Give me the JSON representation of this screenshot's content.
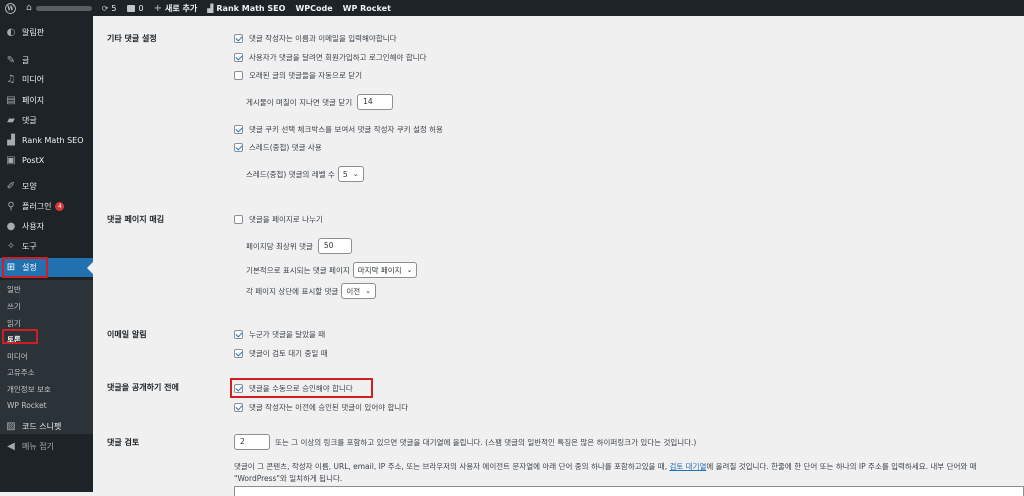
{
  "adminbar": {
    "updates_count": "5",
    "comments_count": "0",
    "new_label": "새로 추가",
    "plugins": [
      "Rank Math SEO",
      "WPCode",
      "WP Rocket"
    ]
  },
  "sidebar": {
    "items": [
      {
        "label": "알림판",
        "icon": "dashboard-icon"
      },
      {
        "label": "글",
        "icon": "pin-icon"
      },
      {
        "label": "미디어",
        "icon": "media-icon"
      },
      {
        "label": "페이지",
        "icon": "page-icon"
      },
      {
        "label": "댓글",
        "icon": "comment-icon"
      },
      {
        "label": "Rank Math SEO",
        "icon": "chart-icon"
      },
      {
        "label": "PostX",
        "icon": "postx-icon"
      },
      {
        "label": "모양",
        "icon": "brush-icon"
      },
      {
        "label": "플러그인",
        "icon": "plugin-icon",
        "badge": "4"
      },
      {
        "label": "사용자",
        "icon": "user-icon"
      },
      {
        "label": "도구",
        "icon": "wrench-icon"
      },
      {
        "label": "설정",
        "icon": "settings-icon"
      }
    ],
    "submenu": [
      "일반",
      "쓰기",
      "읽기",
      "토론",
      "미디어",
      "고유주소",
      "개인정보 보호",
      "WP Rocket"
    ],
    "after": [
      {
        "label": "코드 스니펫",
        "icon": "code-icon"
      },
      {
        "label": "메뉴 접기",
        "icon": "collapse-icon"
      }
    ]
  },
  "sections": {
    "other": {
      "title": "기타 댓글 설정",
      "opt1": "댓글 작성자는 이름과 이메일을 입력해야합니다",
      "opt2": "사용자가 댓글을 달려면 회원가입하고 로그인해야 합니다",
      "opt3": "오래된 글의 댓글들을 자동으로 닫기",
      "close_label": "게시물이 며칠이 지나면 댓글 닫기",
      "close_days": "14",
      "opt4": "댓글 쿠키 선택 체크박스를 보여서 댓글 작성자 쿠키 설정 허용",
      "opt5": "스레드(중첩) 댓글 사용",
      "levels_label": "스레드(중첩) 댓글의 레벨 수",
      "levels_value": "5"
    },
    "paging": {
      "title": "댓글 페이지 매김",
      "opt": "댓글을 페이지로 나누기",
      "top_label": "페이지당 최상위 댓글",
      "top_value": "50",
      "default_label": "기본적으로 표시되는 댓글 페이지",
      "default_value": "마지막 페이지",
      "order_label": "각 페이지 상단에 표시할 댓글",
      "order_value": "이전"
    },
    "email": {
      "title": "이메일 알림",
      "opt1": "누군가 댓글을 달았을 때",
      "opt2": "댓글이 검토 대기 중일 때"
    },
    "before": {
      "title": "댓글을 공개하기 전에",
      "opt1": "댓글을 수동으로 승인해야 합니다",
      "opt2": "댓글 작성자는 이전에 승인된 댓글이 있어야 합니다"
    },
    "moderation": {
      "title": "댓글 검토",
      "links_value": "2",
      "links_text": "또는 그 이상의 링크를 포함하고 있으면 댓글을 대기열에 올립니다. (스팸 댓글의 일반적인 특징은 많은 하이퍼링크가 있다는 것입니다.)",
      "desc_pre": "댓글이 그 콘텐츠, 작성자 이름, URL, email, IP 주소, 또는 브라우저의 사용자 에이전트 문자열에 아래 단어 중의 하나를 포함하고있을 때, ",
      "desc_link": "검토 대기열",
      "desc_post": "에 올려질 것입니다. 한줄에 한 단어 또는 하나의 IP 주소를 입력하세요. 내부 단어와 매",
      "desc_line2": "\"WordPress\"와 일치하게 됩니다."
    }
  }
}
